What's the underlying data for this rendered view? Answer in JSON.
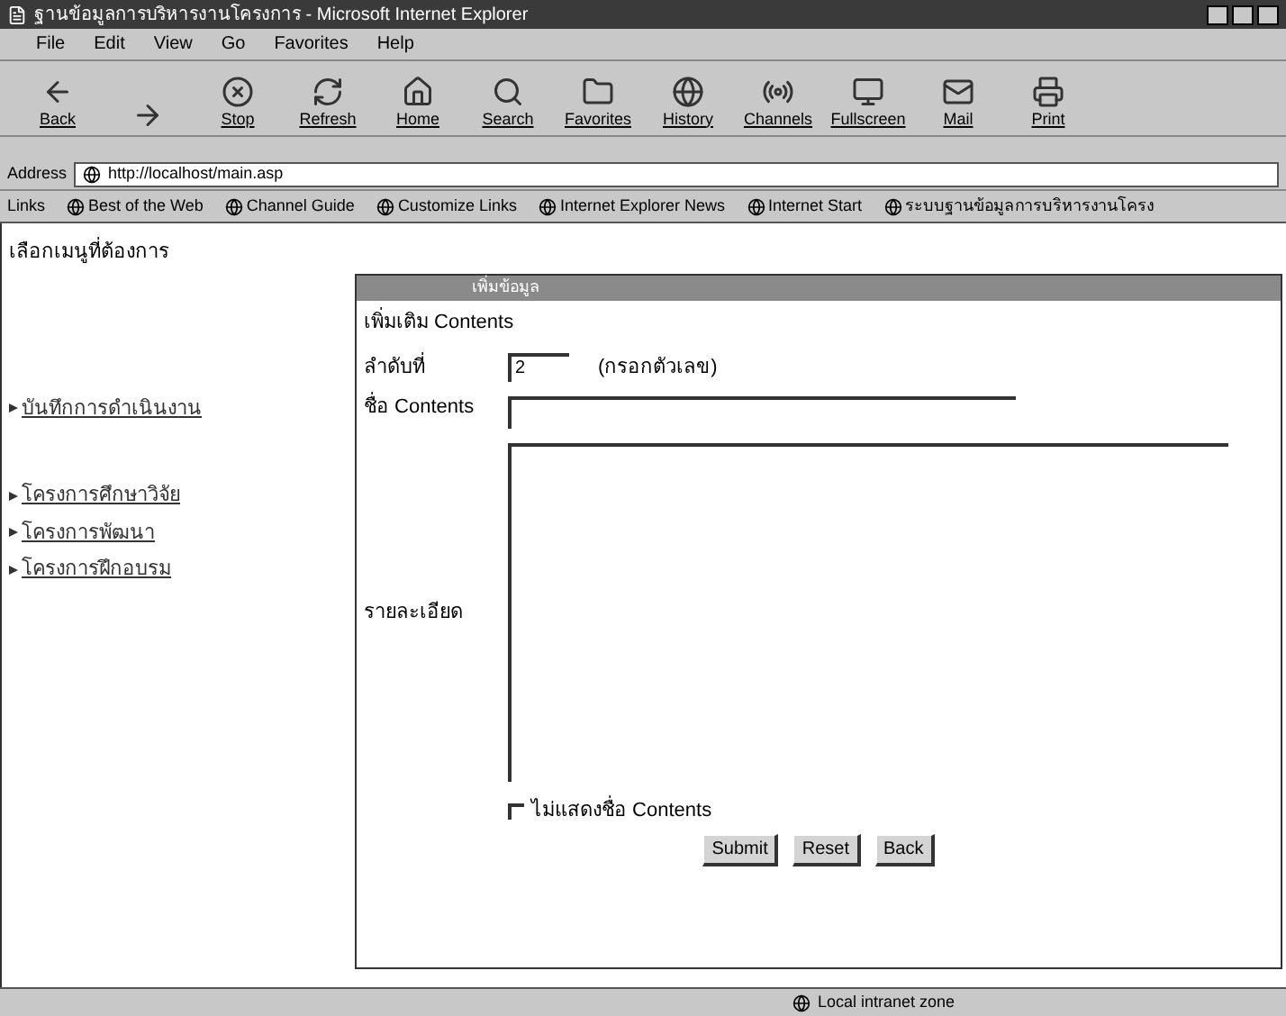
{
  "window": {
    "title": "ฐานข้อมูลการบริหารงานโครงการ - Microsoft Internet Explorer"
  },
  "menu": [
    "File",
    "Edit",
    "View",
    "Go",
    "Favorites",
    "Help"
  ],
  "toolbar": [
    {
      "kind": "back",
      "label": "Back"
    },
    {
      "kind": "forward"
    },
    {
      "kind": "stop",
      "label": "Stop"
    },
    {
      "kind": "refresh",
      "label": "Refresh"
    },
    {
      "kind": "home",
      "label": "Home"
    },
    {
      "kind": "search",
      "label": "Search"
    },
    {
      "kind": "favorites",
      "label": "Favorites"
    },
    {
      "kind": "history",
      "label": "History"
    },
    {
      "kind": "channels",
      "label": "Channels"
    },
    {
      "kind": "fullscreen",
      "label": "Fullscreen"
    },
    {
      "kind": "mail",
      "label": "Mail"
    },
    {
      "kind": "print",
      "label": "Print"
    }
  ],
  "address": {
    "label": "Address",
    "value": "http://localhost/main.asp"
  },
  "links": {
    "label": "Links",
    "items": [
      "Best of the Web",
      "Channel Guide",
      "Customize Links",
      "Internet Explorer News",
      "Internet Start",
      "ระบบฐานข้อมูลการบริหารงานโครง"
    ]
  },
  "sidebar": {
    "title": "เลือกเมนูที่ต้องการ",
    "items": [
      "บันทึกการดำเนินงาน",
      "โครงการศึกษาวิจัย",
      "โครงการพัฒนา",
      "โครงการฝึกอบรม"
    ]
  },
  "dialog": {
    "title": "เพิ่มข้อมูล",
    "heading": "เพิ่มเติม Contents",
    "order": {
      "label": "ลำดับที่",
      "value": "2",
      "hint": "(กรอกตัวเลข)"
    },
    "name": {
      "label": "ชื่อ Contents"
    },
    "detail": {
      "label": "รายละเอียด"
    },
    "hide_name": {
      "label": "ไม่แสดงชื่อ Contents",
      "checked": false
    },
    "buttons": [
      "Submit",
      "Reset",
      "Back"
    ]
  },
  "status_bar": {
    "zone": "Local intranet zone"
  }
}
